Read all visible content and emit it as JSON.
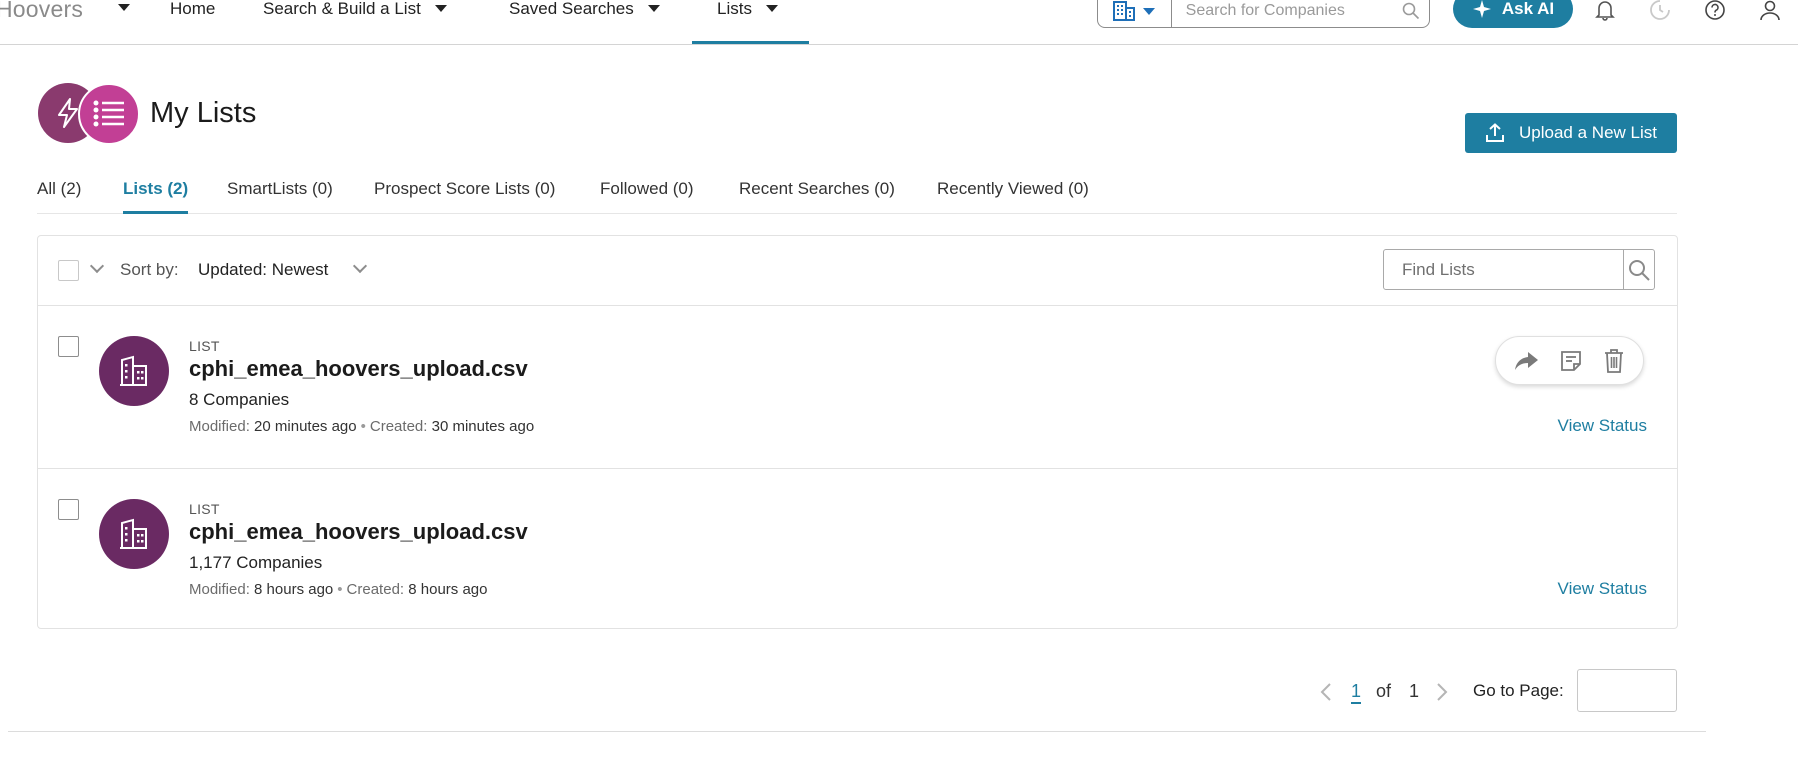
{
  "topnav": {
    "brand": "Hoovers",
    "items": [
      {
        "label": "Home"
      },
      {
        "label": "Search & Build a List"
      },
      {
        "label": "Saved Searches"
      },
      {
        "label": "Lists"
      }
    ],
    "search_placeholder": "Search for Companies",
    "ask_ai_label": "Ask AI"
  },
  "header": {
    "title": "My Lists",
    "upload_label": "Upload a New List"
  },
  "tabs": [
    {
      "label": "All (2)"
    },
    {
      "label": "Lists (2)"
    },
    {
      "label": "SmartLists (0)"
    },
    {
      "label": "Prospect Score Lists (0)"
    },
    {
      "label": "Followed (0)"
    },
    {
      "label": "Recent Searches (0)"
    },
    {
      "label": "Recently Viewed (0)"
    }
  ],
  "toolbar": {
    "sort_label": "Sort by:",
    "sort_value": "Updated: Newest",
    "find_placeholder": "Find Lists"
  },
  "lists": [
    {
      "type": "LIST",
      "name": "cphi_emea_hoovers_upload.csv",
      "count": "8 Companies",
      "modified_label": "Modified:",
      "modified": "20 minutes ago",
      "created_label": "Created:",
      "created": "30 minutes ago",
      "status_link": "View Status"
    },
    {
      "type": "LIST",
      "name": "cphi_emea_hoovers_upload.csv",
      "count": "1,177 Companies",
      "modified_label": "Modified:",
      "modified": "8 hours ago",
      "created_label": "Created:",
      "created": "8 hours ago",
      "status_link": "View Status"
    }
  ],
  "pagination": {
    "current": "1",
    "of": "of",
    "total": "1",
    "goto_label": "Go to Page:"
  },
  "colors": {
    "accent": "#1e7ea1",
    "badge_dark": "#8a3a6e",
    "badge_pink": "#c23f95",
    "list_avatar": "#6a2a63"
  }
}
